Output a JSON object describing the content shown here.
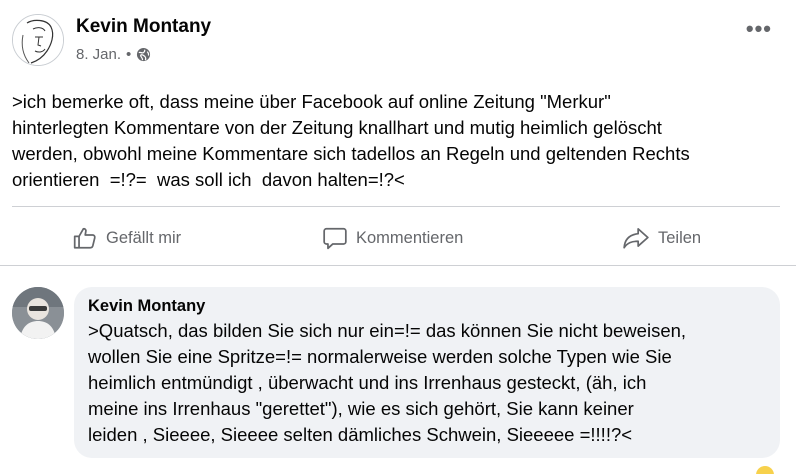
{
  "post": {
    "author": "Kevin Montany",
    "date": "8. Jan.",
    "separator": "•",
    "privacy_icon": "globe-icon",
    "more_icon": "more-options-icon",
    "text": ">ich bemerke oft, dass meine über Facebook auf online Zeitung \"Merkur\"\nhinterlegten Kommentare von der Zeitung knallhart und mutig heimlich gelöscht\nwerden, obwohl meine Kommentare sich tadellos an Regeln und geltenden Rechts\norientieren  =!?=  was soll ich  davon halten=!?<"
  },
  "actions": {
    "like_label": "Gefällt mir",
    "comment_label": "Kommentieren",
    "share_label": "Teilen"
  },
  "comment": {
    "author": "Kevin Montany",
    "text": ">Quatsch, das bilden Sie sich nur ein=!= das können Sie nicht beweisen,\nwollen Sie eine Spritze=!= normalerweise werden solche Typen wie Sie\nheimlich entmündigt , überwacht und ins Irrenhaus gesteckt, (äh, ich\nmeine ins Irrenhaus \"gerettet\"), wie es sich gehört, Sie kann keiner\nleiden , Sieeee, Sieeee selten dämliches Schwein, Sieeeee =!!!!?<"
  },
  "colors": {
    "text_primary": "#050505",
    "text_secondary": "#65676b",
    "bubble_bg": "#f0f2f5",
    "divider": "#ced0d4"
  }
}
